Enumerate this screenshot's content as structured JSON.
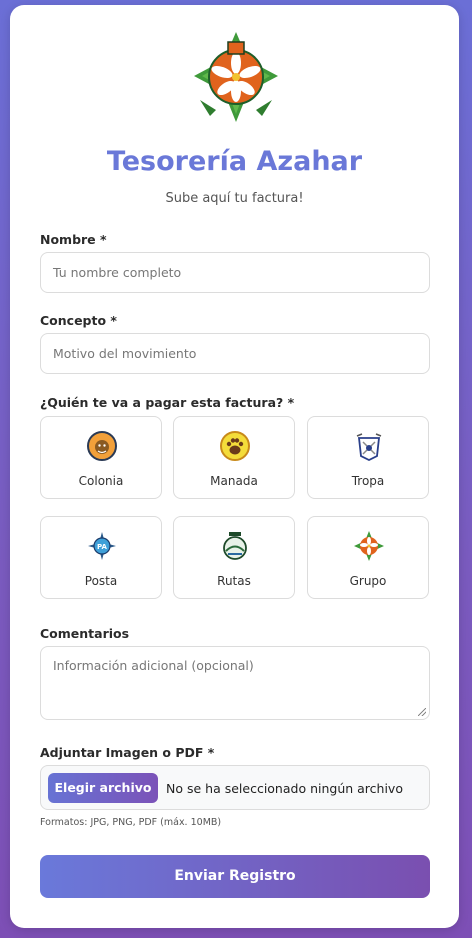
{
  "header": {
    "title": "Tesorería Azahar",
    "subtitle": "Sube aquí tu factura!"
  },
  "form": {
    "nombre": {
      "label": "Nombre *",
      "placeholder": "Tu nombre completo"
    },
    "concepto": {
      "label": "Concepto *",
      "placeholder": "Motivo del movimiento"
    },
    "pagador": {
      "label": "¿Quién te va a pagar esta factura? *",
      "options": [
        {
          "label": "Colonia",
          "icon": "colonia-badge-icon"
        },
        {
          "label": "Manada",
          "icon": "manada-paw-badge-icon"
        },
        {
          "label": "Tropa",
          "icon": "tropa-badge-icon"
        },
        {
          "label": "Posta",
          "icon": "posta-compass-badge-icon"
        },
        {
          "label": "Rutas",
          "icon": "rutas-clan-badge-icon"
        },
        {
          "label": "Grupo",
          "icon": "grupo-azahar-badge-icon"
        }
      ]
    },
    "comentarios": {
      "label": "Comentarios",
      "placeholder": "Información adicional (opcional)"
    },
    "adjunto": {
      "label": "Adjuntar Imagen o PDF *",
      "button": "Elegir archivo",
      "status": "No se ha seleccionado ningún archivo",
      "hint": "Formatos: JPG, PNG, PDF (máx. 10MB)"
    },
    "submit": "Enviar Registro"
  },
  "colors": {
    "accent": "#6a78d8",
    "gradient_start": "#6a79da",
    "gradient_end": "#7a4fb0",
    "logo_orange": "#e0631d",
    "logo_green": "#3f9a3a"
  }
}
